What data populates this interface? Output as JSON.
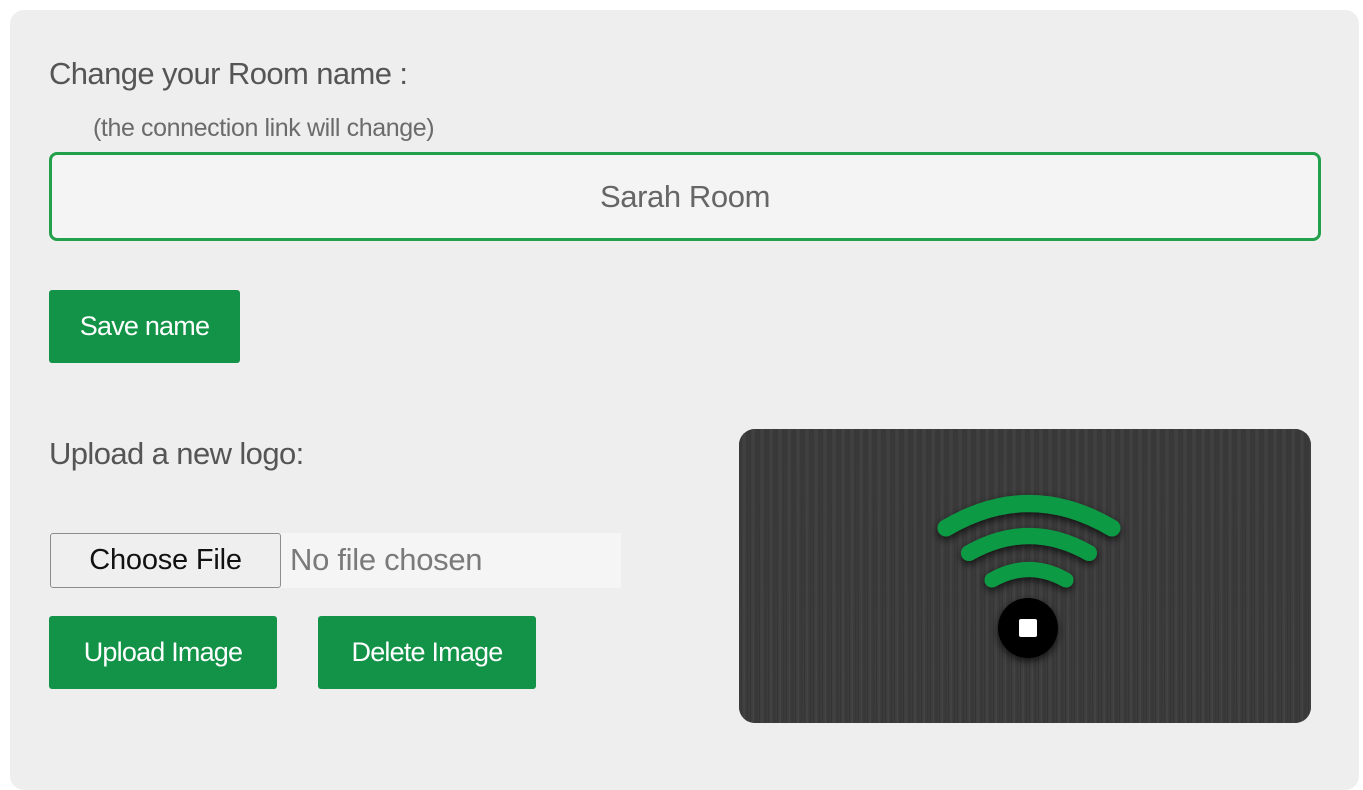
{
  "room": {
    "title": "Change your Room name :",
    "subtitle": "(the connection link will change)",
    "name_value": "Sarah Room",
    "save_label": "Save name"
  },
  "logo": {
    "title": "Upload a new logo:",
    "choose_file_label": "Choose File",
    "file_status": "No file chosen",
    "upload_label": "Upload Image",
    "delete_label": "Delete Image",
    "preview_icon": "wifi-signal-icon"
  },
  "colors": {
    "accent": "#129347",
    "input_border": "#22a04b",
    "panel_bg": "#eeeeee",
    "preview_bg": "#3b3b3b",
    "wifi_green": "#0f9a45"
  }
}
